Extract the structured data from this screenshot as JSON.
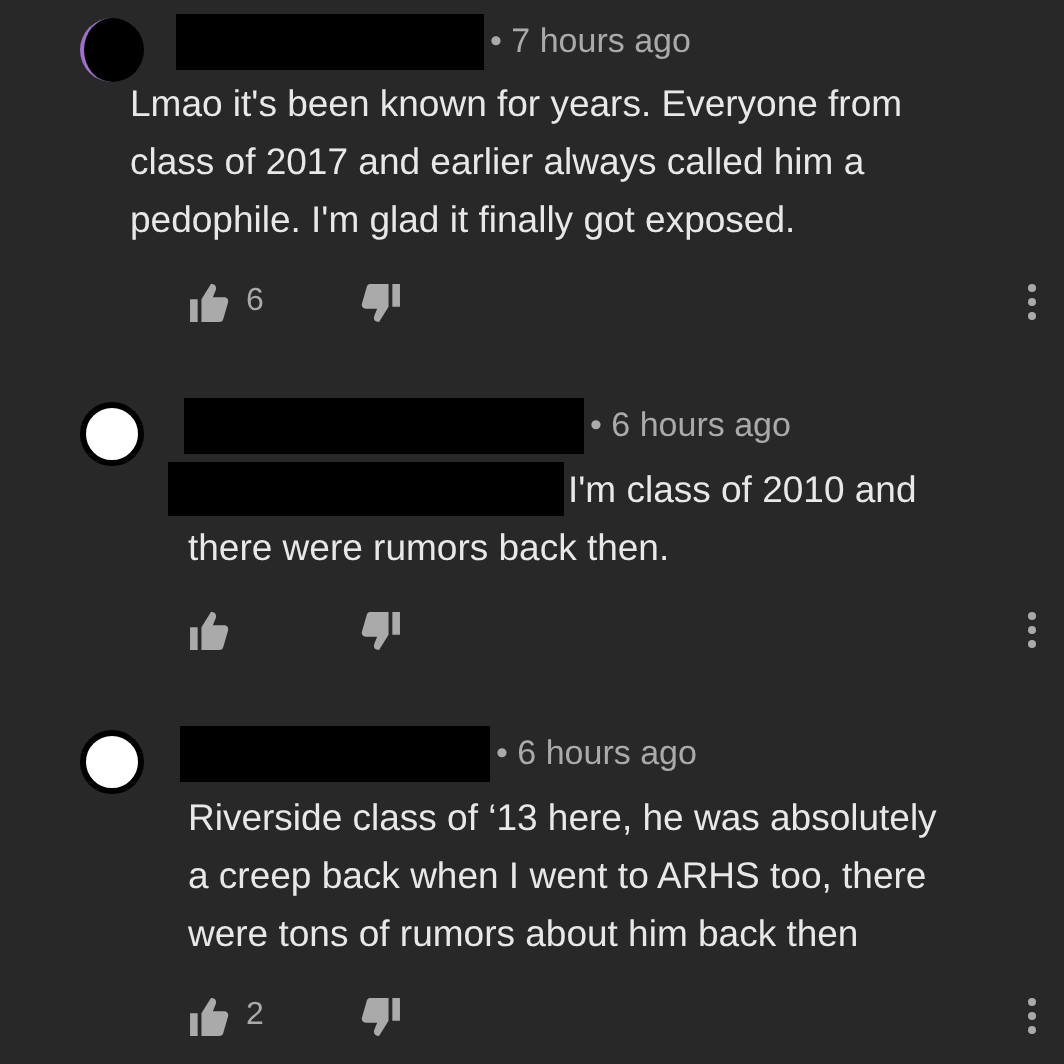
{
  "comments": [
    {
      "kind": "dark",
      "time": "• 7 hours ago",
      "redacted_lead": false,
      "lines": [
        "Lmao it's been known for years. Everyone from",
        "class of 2017 and earlier always called him a",
        "pedophile. I'm glad it finally got exposed."
      ],
      "likes": "6"
    },
    {
      "kind": "light",
      "time": "• 6 hours ago",
      "redacted_lead": true,
      "lines": [
        "I'm class of 2010 and",
        "there were rumors back then."
      ]
    },
    {
      "kind": "light",
      "time": "• 6 hours ago",
      "redacted_lead": false,
      "lines": [
        "Riverside class of ‘13 here, he was absolutely",
        "a creep back when I went to ARHS too, there",
        "were tons of rumors about him back then"
      ],
      "likes": "2"
    }
  ]
}
